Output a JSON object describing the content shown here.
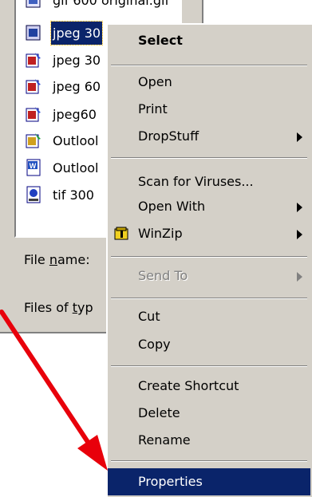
{
  "file_list": {
    "items": [
      {
        "name": "gif 600 original.gif",
        "icon": "gif-file-icon",
        "selected": false
      },
      {
        "name": "jpeg 30",
        "icon": "jpeg-file-icon",
        "selected": true
      },
      {
        "name": "jpeg 30",
        "icon": "jpeg-file-icon",
        "selected": false
      },
      {
        "name": "jpeg 60",
        "icon": "jpeg-file-icon",
        "selected": false
      },
      {
        "name": "jpeg60",
        "icon": "jpeg-file-icon",
        "selected": false
      },
      {
        "name": "Outlool",
        "icon": "outlook-file-icon",
        "selected": false
      },
      {
        "name": "Outlool",
        "icon": "word-document-icon",
        "selected": false
      },
      {
        "name": "tif 300",
        "icon": "tif-file-icon",
        "selected": false
      }
    ]
  },
  "dialog": {
    "file_name_label_pre": "File ",
    "file_name_label_u": "n",
    "file_name_label_post": "ame:",
    "files_of_type_label_pre": "Files of ",
    "files_of_type_label_u": "t",
    "files_of_type_label_post": "yp"
  },
  "context_menu": {
    "select": "Select",
    "open": "Open",
    "print": "Print",
    "dropstuff": "DropStuff",
    "scan_for_viruses": "Scan for Viruses...",
    "open_with": "Open With",
    "winzip": "WinZip",
    "send_to": "Send To",
    "cut": "Cut",
    "copy": "Copy",
    "create_shortcut": "Create Shortcut",
    "delete": "Delete",
    "rename": "Rename",
    "properties": "Properties"
  },
  "colors": {
    "selection": "#0a246a",
    "face": "#d4d0c8",
    "arrow": "#e8000b"
  }
}
